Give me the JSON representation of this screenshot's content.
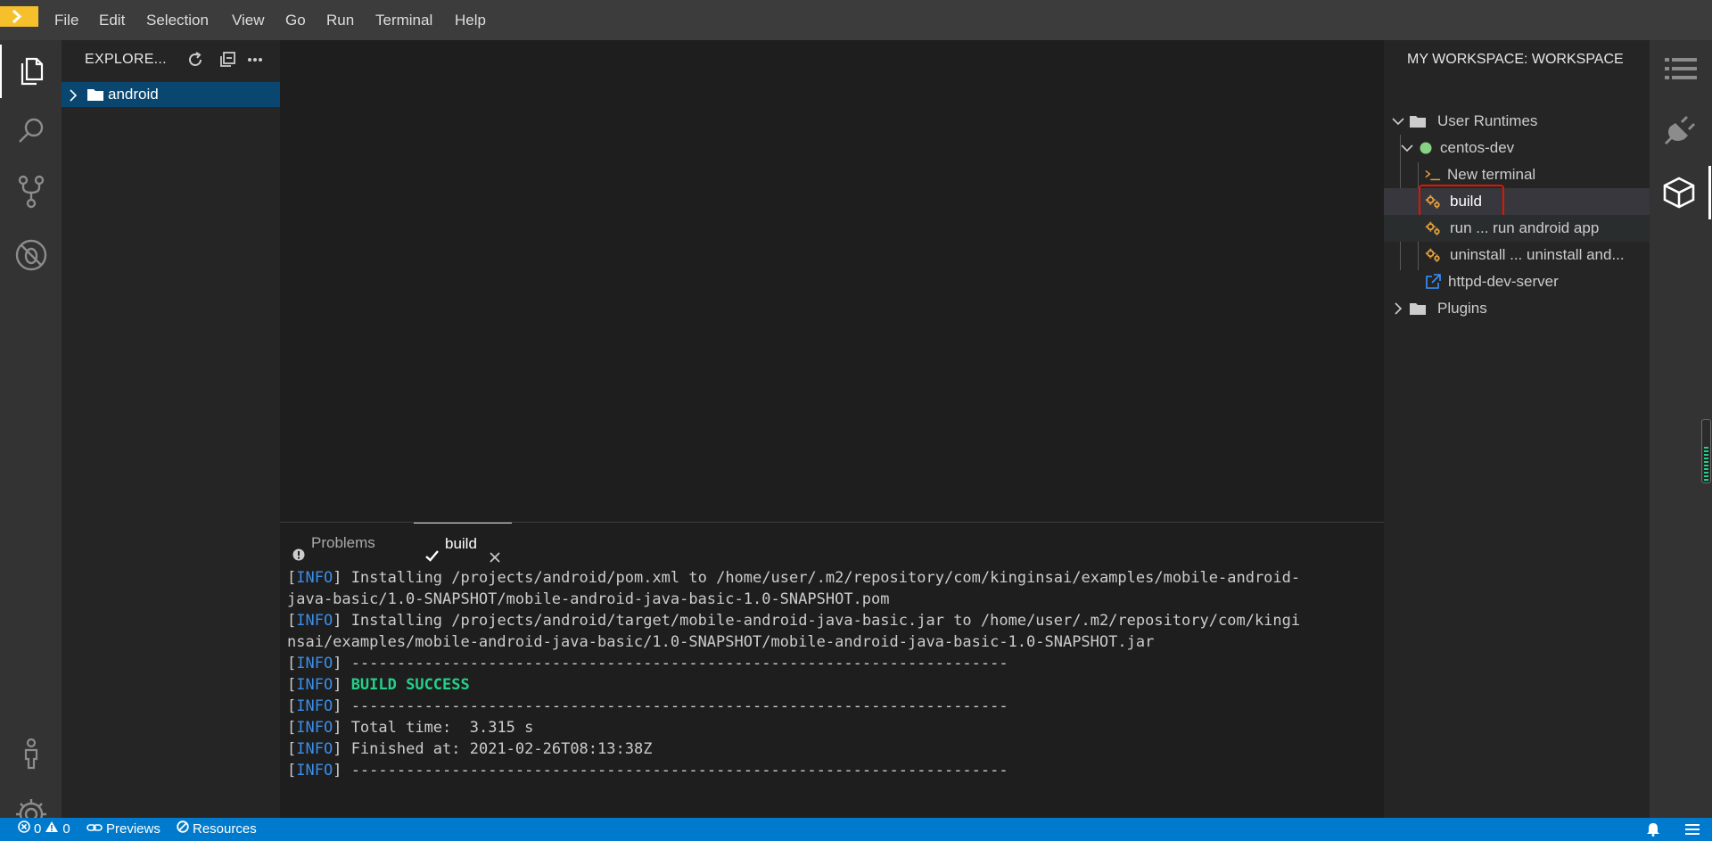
{
  "menubar": {
    "items": [
      "File",
      "Edit",
      "Selection",
      "View",
      "Go",
      "Run",
      "Terminal",
      "Help"
    ]
  },
  "explorer": {
    "title": "EXPLORE...",
    "tree": [
      {
        "label": "android"
      }
    ]
  },
  "panel": {
    "tabs": [
      {
        "label": "Problems"
      },
      {
        "label": "build"
      }
    ],
    "terminal_lines": [
      {
        "tag": "INFO",
        "text": "Installing /projects/android/pom.xml to /home/user/.m2/repository/com/kinginsai/examples/mobile-android-"
      },
      {
        "tag": "",
        "text": "java-basic/1.0-SNAPSHOT/mobile-android-java-basic-1.0-SNAPSHOT.pom"
      },
      {
        "tag": "INFO",
        "text": "Installing /projects/android/target/mobile-android-java-basic.jar to /home/user/.m2/repository/com/kingi"
      },
      {
        "tag": "",
        "text": "nsai/examples/mobile-android-java-basic/1.0-SNAPSHOT/mobile-android-java-basic-1.0-SNAPSHOT.jar"
      },
      {
        "tag": "INFO",
        "text": "------------------------------------------------------------------------"
      },
      {
        "tag": "INFO",
        "text": "BUILD SUCCESS",
        "success": true
      },
      {
        "tag": "INFO",
        "text": "------------------------------------------------------------------------"
      },
      {
        "tag": "INFO",
        "text": "Total time:  3.315 s"
      },
      {
        "tag": "INFO",
        "text": "Finished at: 2021-02-26T08:13:38Z"
      },
      {
        "tag": "INFO",
        "text": "------------------------------------------------------------------------"
      }
    ]
  },
  "workspace": {
    "title": "MY WORKSPACE: WORKSPACE",
    "user_runtimes": "User Runtimes",
    "runtime_name": "centos-dev",
    "commands": [
      {
        "label": "New terminal",
        "icon": "terminal-icon"
      },
      {
        "label": "build",
        "icon": "gears-icon"
      },
      {
        "label": "run ... run android app",
        "icon": "gears-icon"
      },
      {
        "label": "uninstall ... uninstall and...",
        "icon": "gears-icon"
      },
      {
        "label": "httpd-dev-server",
        "icon": "external-link-icon"
      }
    ],
    "plugins": "Plugins"
  },
  "statusbar": {
    "errors": "0",
    "warnings": "0",
    "previews": "Previews",
    "resources": "Resources"
  },
  "colors": {
    "accent": "#007acc",
    "selection": "#094771",
    "logo": "#f6c02c",
    "info": "#3b8eea",
    "success": "#23d18b",
    "highlight_box": "#e51400",
    "runtime_dot": "#89d185",
    "command_icon": "#e8a23a"
  }
}
